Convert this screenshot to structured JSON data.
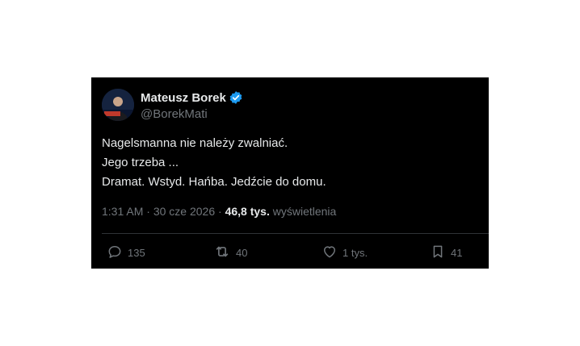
{
  "author": {
    "name": "Mateusz Borek",
    "handle": "@BorekMati",
    "verified": true,
    "verified_color": "#1d9bf0"
  },
  "tweet": {
    "lines": [
      "Nagelsmanna nie należy zwalniać.",
      "Jego trzeba ...",
      "Dramat. Wstyd. Hańba. Jedźcie do domu."
    ],
    "time": "1:31 AM",
    "date": "30 cze 2026",
    "separator": "·",
    "views_count": "46,8 tys.",
    "views_label": "wyświetlenia"
  },
  "actions": {
    "replies": "135",
    "retweets": "40",
    "likes": "1 tys.",
    "bookmarks": "41"
  },
  "icons": {
    "reply": "reply-icon",
    "retweet": "retweet-icon",
    "like": "heart-icon",
    "bookmark": "bookmark-icon",
    "verified": "verified-badge-icon"
  },
  "colors": {
    "background": "#000000",
    "text": "#e7e9ea",
    "muted": "#71767b",
    "divider": "#2f3336"
  }
}
